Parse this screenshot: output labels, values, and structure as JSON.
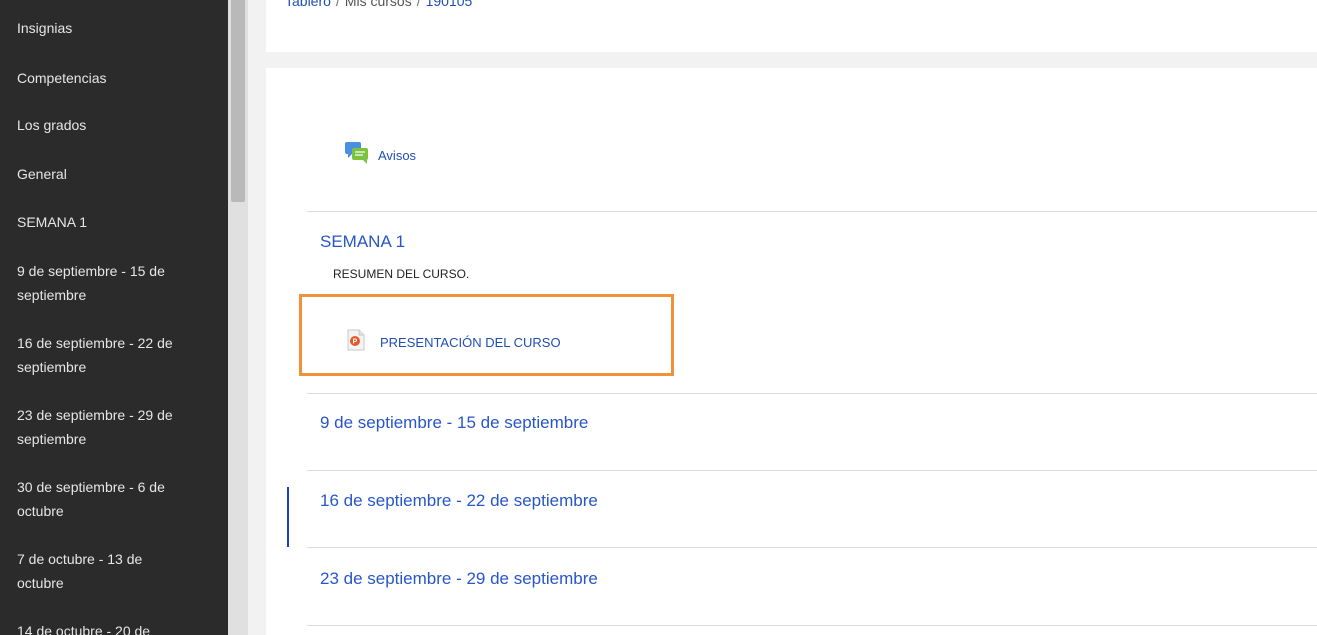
{
  "sidebar": {
    "items": [
      {
        "label": "Insignias"
      },
      {
        "label": "Competencias"
      },
      {
        "label": "Los grados"
      },
      {
        "label": "General"
      },
      {
        "label": "SEMANA 1"
      },
      {
        "label": "9 de septiembre - 15 de septiembre"
      },
      {
        "label": "16 de septiembre - 22 de septiembre"
      },
      {
        "label": "23 de septiembre - 29 de septiembre"
      },
      {
        "label": "30 de septiembre - 6 de octubre"
      },
      {
        "label": "7 de octubre - 13 de octubre"
      },
      {
        "label": "14 de octubre - 20 de"
      }
    ]
  },
  "breadcrumb": {
    "items": [
      "Tablero",
      "Mis cursos",
      "190105"
    ]
  },
  "main": {
    "avisos": {
      "label": "Avisos",
      "icon": "forum-icon"
    },
    "sections": [
      {
        "title": "SEMANA 1",
        "summary": "RESUMEN DEL CURSO.",
        "activity": {
          "label": "PRESENTACIÓN DEL CURSO",
          "icon": "powerpoint-file-icon"
        }
      },
      {
        "title": "9 de septiembre - 15 de septiembre"
      },
      {
        "title": "16 de septiembre - 22 de septiembre"
      },
      {
        "title": "23 de septiembre - 29 de septiembre"
      }
    ]
  },
  "colors": {
    "sidebar_bg": "#2b2b2b",
    "link": "#1f4fb3",
    "highlight": "#f0923a",
    "current_marker": "#2040c0"
  }
}
